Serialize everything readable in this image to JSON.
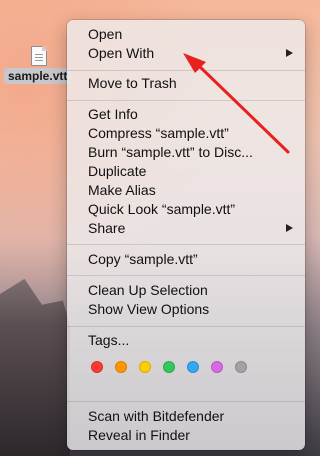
{
  "desktop": {
    "file_name": "sample.vtt",
    "file_icon": "document-icon"
  },
  "menu": {
    "open": "Open",
    "open_with": "Open With",
    "move_to_trash": "Move to Trash",
    "get_info": "Get Info",
    "compress": "Compress “sample.vtt”",
    "burn": "Burn “sample.vtt” to Disc...",
    "duplicate": "Duplicate",
    "make_alias": "Make Alias",
    "quick_look": "Quick Look “sample.vtt”",
    "share": "Share",
    "copy": "Copy “sample.vtt”",
    "clean_up": "Clean Up Selection",
    "show_view_options": "Show View Options",
    "tags": "Tags...",
    "scan": "Scan with Bitdefender",
    "reveal": "Reveal in Finder",
    "submenu_icon": "chevron-right-icon"
  },
  "tag_colors": [
    "#ff3b30",
    "#ff9500",
    "#ffcc00",
    "#34c759",
    "#32a8f0",
    "#d869e6",
    "#a3a3a5"
  ],
  "annotation": {
    "arrow_color": "#e8211f",
    "icon": "red-arrow-annotation"
  }
}
